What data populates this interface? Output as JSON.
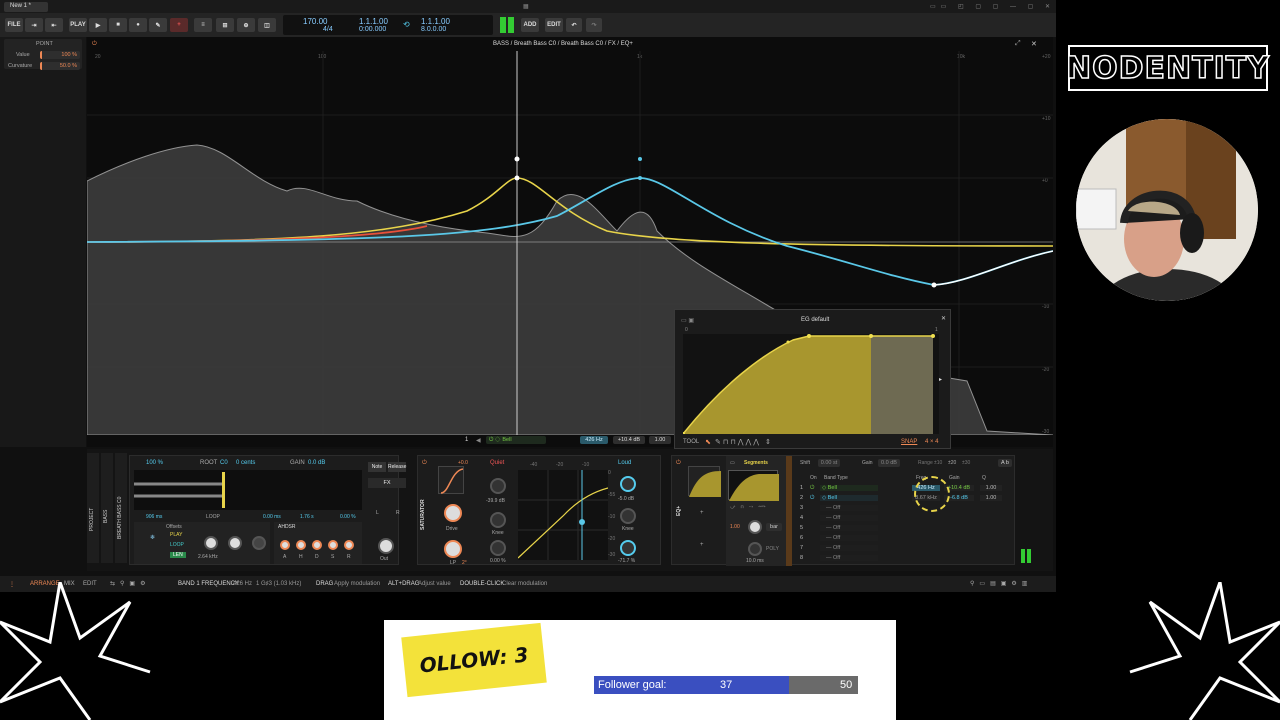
{
  "tab": {
    "title": "New 1 *"
  },
  "toolbar": {
    "file": "FILE",
    "play": "PLAY",
    "tempo": "170.00",
    "signature": "4/4",
    "position": "1.1.1.00",
    "time": "0:00.000",
    "loop_start": "1.1.1.00",
    "loop_end": "8.0.0.00",
    "add": "ADD",
    "edit": "EDIT"
  },
  "inspector": {
    "title": "POINT",
    "value_label": "Value",
    "value": "100 %",
    "curvature_label": "Curvature",
    "curvature": "50.0 %"
  },
  "editor": {
    "breadcrumb": "BASS / Breath Bass C0 / Breath Bass C0 / FX / EQ+",
    "freq_ticks": [
      "20",
      "100",
      "1k",
      "10k"
    ],
    "db_ticks": [
      "+20",
      "+10",
      "+0",
      "-10",
      "-20",
      "-30"
    ],
    "band_number": "1",
    "band_type": "Bell",
    "band_freq": "426 Hz",
    "band_gain": "+10.4 dB",
    "band_q": "1.00"
  },
  "eg_popup": {
    "title": "EG default",
    "y_top": "1",
    "y_bottom": "0",
    "tool": "TOOL",
    "snap": "SNAP",
    "grid": "4 × 4"
  },
  "device_chain": {
    "track": "PROJECT",
    "bass": "BASS",
    "instrument": "BREATH BASS C0",
    "sampler": {
      "volume": "100 %",
      "root_label": "ROOT",
      "root": "C0",
      "cents": "0 cents",
      "gain_label": "GAIN",
      "gain": "0.0 dB",
      "note": "Note",
      "release": "Release",
      "fx": "FX",
      "length": "906 ms",
      "loop_label": "LOOP",
      "loop_a": "0.00 ms",
      "loop_b": "1.76 s",
      "loop_c": "0.00 %",
      "offsets": "Offsets",
      "play": "PLAY",
      "loop": "LOOP",
      "len": "LEN",
      "freq": "2.64 kHz",
      "ahdsr": "AHDSR",
      "env_labels": [
        "A",
        "H",
        "D",
        "S",
        "R"
      ],
      "out": "Out",
      "lr": [
        "L",
        "R"
      ]
    },
    "saturator": {
      "name": "SATURATOR",
      "quiet": "Quiet",
      "loud": "Loud",
      "drive_val": "+0.0",
      "drive_db": "-39.9 dB",
      "drive": "Drive",
      "knee": "Knee",
      "knee_val": "0.00 %",
      "loud_db": "-5.0 dB",
      "loud_knee": "Knee",
      "loud_pct": "-71.7 %",
      "lp": "LP",
      "lp_val": "2°",
      "scale": [
        "-40",
        "-20",
        "-10"
      ],
      "scale_r": [
        "0",
        "-55",
        "-10",
        "-20",
        "-30"
      ]
    },
    "eq": {
      "name": "EQ+",
      "segments": "Segments",
      "seg_val": "1.00",
      "seg_time": "10.0 ms",
      "bar": "bar",
      "poly": "POLY",
      "shift_label": "Shift",
      "shift": "0.00 st",
      "gain_label": "Gain",
      "gain": "0.0 dB",
      "range_label": "Range",
      "range": [
        "±10",
        "±20",
        "±30"
      ],
      "ab": "A b",
      "cols": [
        "On",
        "Band Type",
        "Freq",
        "Gain",
        "Q"
      ],
      "bands": [
        {
          "n": "1",
          "type": "Bell",
          "freq": "426 Hz",
          "gain": "+10.4 dB",
          "q": "1.00"
        },
        {
          "n": "2",
          "type": "Bell",
          "freq": "8.67 kHz",
          "gain": "-6.8 dB",
          "q": "1.00"
        },
        {
          "n": "3",
          "type": "Off"
        },
        {
          "n": "4",
          "type": "Off"
        },
        {
          "n": "5",
          "type": "Off"
        },
        {
          "n": "6",
          "type": "Off"
        },
        {
          "n": "7",
          "type": "Off"
        },
        {
          "n": "8",
          "type": "Off"
        }
      ]
    }
  },
  "statusbar": {
    "arrange": "ARRANGE",
    "mix": "MIX",
    "edit": "EDIT",
    "param": "BAND 1 FREQUENCY",
    "param_val": "426 Hz",
    "param_note": "1 G♯3 (1.03 kHz)",
    "drag": "DRAG",
    "drag_desc": "Apply modulation",
    "altdrag": "ALT+DRAG",
    "altdrag_desc": "Adjust value",
    "dbl": "DOUBLE-CLICK",
    "dbl_desc": "Clear modulation"
  },
  "overlay": {
    "logo": "NODENTITY",
    "follow_text": "OLLOW: 3",
    "goal_label": "Follower goal:",
    "goal_current": "37",
    "goal_target": "50",
    "goal_progress": 0.74,
    "colors": {
      "accent": "#f5a623",
      "eq_band1": "#e8d44a",
      "eq_band2": "#5ac8e8",
      "goal_bar": "#3a4fc0",
      "banner": "#f3e23a"
    }
  }
}
